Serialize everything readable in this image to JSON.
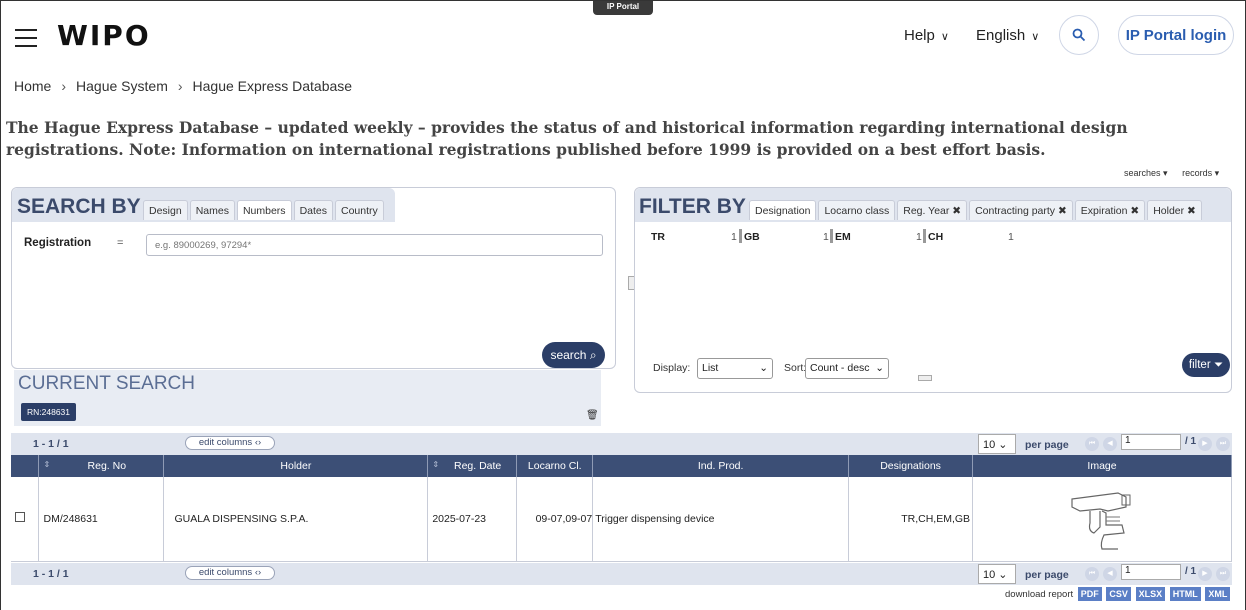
{
  "header": {
    "portal_tab": "IP Portal",
    "logo": "WIPO",
    "help": "Help",
    "language": "English",
    "login": "IP Portal login"
  },
  "breadcrumb": [
    "Home",
    "Hague System",
    "Hague Express Database"
  ],
  "intro": "The Hague Express Database – updated weekly – provides the status of and historical information regarding international design registrations. Note: Information on international registrations published before 1999 is provided on a best effort basis.",
  "top_menus": [
    "searches",
    "records"
  ],
  "search": {
    "title": "SEARCH BY",
    "tabs": [
      "Design",
      "Names",
      "Numbers",
      "Dates",
      "Country"
    ],
    "active_tab": "Numbers",
    "field_label": "Registration",
    "operator": "=",
    "placeholder": "e.g. 89000269, 97294*",
    "button": "search"
  },
  "current_search": {
    "title": "CURRENT SEARCH",
    "chip": "RN:248631"
  },
  "filter": {
    "title": "FILTER BY",
    "tabs": [
      "Designation",
      "Locarno class",
      "Reg. Year",
      "Contracting party",
      "Expiration",
      "Holder"
    ],
    "active_tab": "Designation",
    "items": [
      {
        "code": "TR",
        "count": "1"
      },
      {
        "code": "GB",
        "count": "1"
      },
      {
        "code": "EM",
        "count": "1"
      },
      {
        "code": "CH",
        "count": "1"
      }
    ],
    "display_label": "Display:",
    "display_value": "List",
    "sort_label": "Sort:",
    "sort_value": "Count - desc",
    "button": "filter"
  },
  "pager": {
    "count": "1 - 1 / 1",
    "edit_columns": "edit columns",
    "per_page_value": "10",
    "per_page_label": "per page",
    "page": "1",
    "total_pages": "/ 1"
  },
  "table": {
    "columns": [
      "Reg. No",
      "Holder",
      "Reg. Date",
      "Locarno Cl.",
      "Ind. Prod.",
      "Designations",
      "Image"
    ],
    "rows": [
      {
        "reg_no": "DM/248631",
        "holder": "GUALA DISPENSING S.P.A.",
        "reg_date": "2025-07-23",
        "locarno": "09-07,09-07",
        "ind_prod": "Trigger dispensing device",
        "designations": "TR,CH,EM,GB"
      }
    ]
  },
  "download": {
    "label": "download report",
    "formats": [
      "PDF",
      "CSV",
      "XLSX",
      "HTML",
      "XML"
    ]
  }
}
